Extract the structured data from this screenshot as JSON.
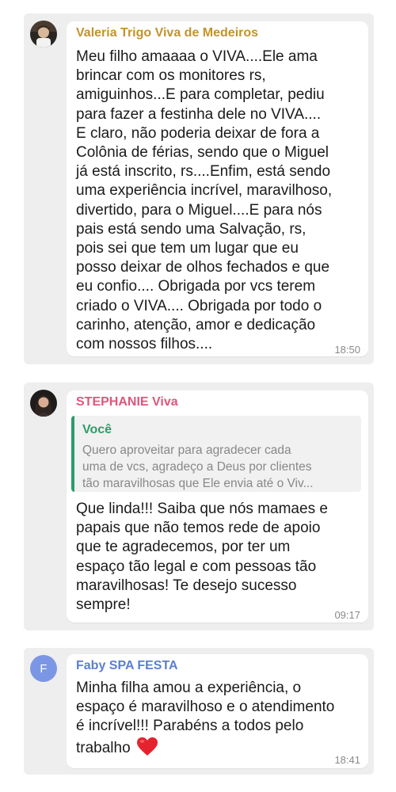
{
  "colors": {
    "panel_background": "#eeeeee",
    "bubble_background": "#ffffff",
    "sender_1": "#c4922b",
    "sender_2": "#e0567a",
    "sender_3": "#5b7fd0",
    "quote_bar": "#2e9c6a",
    "quote_author": "#2e9c6a",
    "avatar_initial_background": "#7b96e4",
    "heart": "#e5232f"
  },
  "messages": [
    {
      "sender": "Valeria Trigo Viva de Medeiros",
      "avatar": "photo",
      "lines": [
        "Meu filho amaaaa o VIVA....Ele ama",
        "brincar com os monitores rs,",
        "amiguinhos...E para completar, pediu",
        "para fazer a festinha dele no VIVA....",
        "E claro, não poderia deixar de fora a",
        "Colônia de férias, sendo que o Miguel",
        "já está inscrito, rs....Enfim, está sendo",
        "uma experiência incrível, maravilhoso,",
        "divertido, para o Miguel....E para nós",
        "pais está sendo uma Salvação, rs,",
        "pois sei que tem um lugar que eu",
        "posso deixar de olhos fechados e que",
        "eu confio.... Obrigada por vcs terem",
        "criado o VIVA.... Obrigada por todo o",
        "carinho, atenção, amor e dedicação",
        "com nossos filhos...."
      ],
      "time": "18:50"
    },
    {
      "sender": "STEPHANIE Viva",
      "avatar": "photo",
      "quote": {
        "author": "Você",
        "lines": [
          "Quero aproveitar para agradecer cada",
          "uma de vcs, agradeço a Deus por clientes",
          "tão maravilhosas que Ele envia até o Viv..."
        ]
      },
      "lines": [
        "Que linda!!! Saiba que nós mamaes e",
        "papais que não temos rede de apoio",
        "que te agradecemos, por ter um",
        "espaço tão legal e com pessoas tão",
        "maravilhosas! Te desejo sucesso",
        "sempre!"
      ],
      "time": "09:17"
    },
    {
      "sender": "Faby SPA FESTA",
      "avatar": "initial",
      "avatar_initial": "F",
      "lines": [
        "Minha filha amou a experiência, o",
        "espaço é maravilhoso e o atendimento",
        "é incrível!!! Parabéns a todos pelo",
        "trabalho"
      ],
      "trailing_emoji": "heart-emoji",
      "time": "18:41"
    }
  ]
}
